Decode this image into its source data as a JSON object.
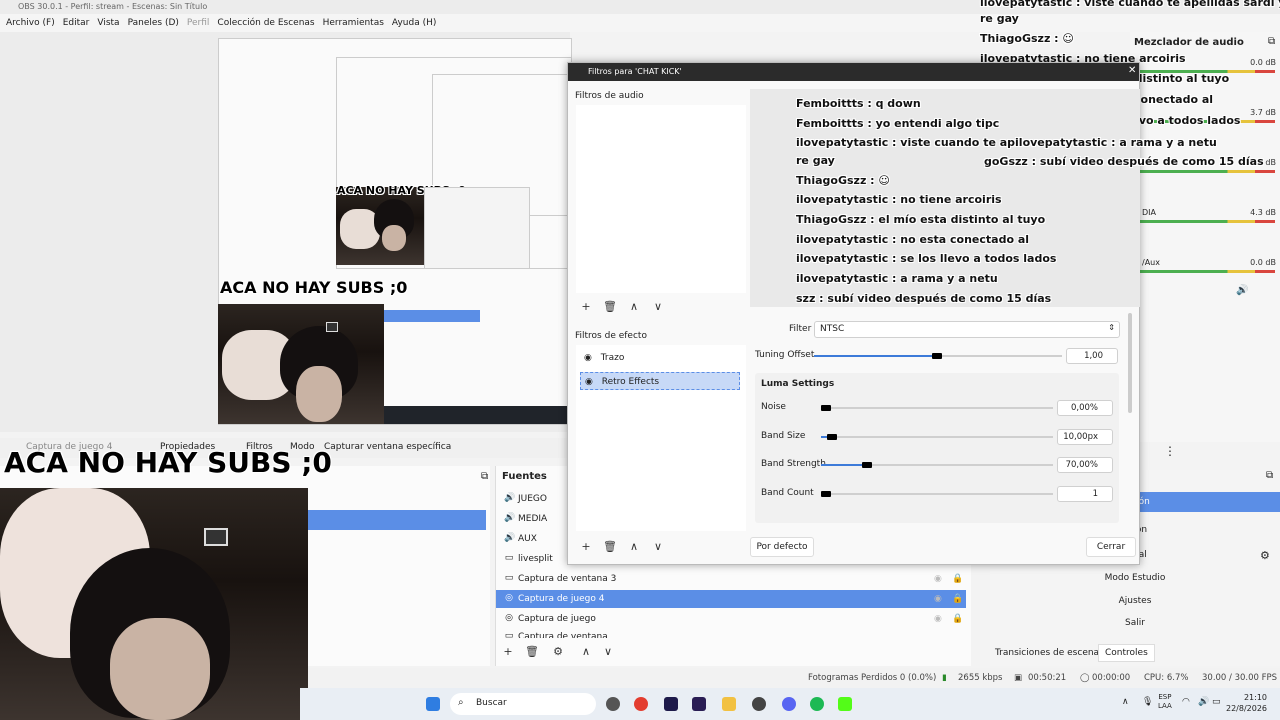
{
  "window": {
    "title": "OBS 30.0.1 - Perfil: stream - Escenas: Sin Título"
  },
  "menu": {
    "items": [
      "Archivo (F)",
      "Editar",
      "Vista",
      "Paneles (D)",
      "Perfil",
      "Colección de Escenas",
      "Herramientas",
      "Ayuda (H)"
    ]
  },
  "preview": {
    "banner": "ACA NO HAY SUBS ;0"
  },
  "source_toolbar": {
    "items": [
      "Captura de juego 4",
      "Propiedades",
      "Filtros",
      "Modo",
      "Capturar ventana específica"
    ]
  },
  "sources": {
    "title": "Fuentes",
    "items": [
      {
        "label": "JUEGO",
        "icon": "speaker-icon"
      },
      {
        "label": "MEDIA",
        "icon": "speaker-icon"
      },
      {
        "label": "AUX",
        "icon": "speaker-icon"
      },
      {
        "label": "livesplit",
        "icon": "window-icon"
      },
      {
        "label": "Captura de ventana 3",
        "icon": "window-icon"
      },
      {
        "label": "Captura de juego 4",
        "icon": "gamepad-icon"
      },
      {
        "label": "Captura de juego",
        "icon": "gamepad-icon"
      },
      {
        "label": "Captura de ventana",
        "icon": "window-icon"
      }
    ]
  },
  "dialog": {
    "title": "Filtros para 'CHAT KICK'",
    "audio_filters_label": "Filtros de audio",
    "effect_filters_label": "Filtros de efecto",
    "effect_filters": [
      "Trazo",
      "Retro Effects"
    ],
    "filter_label": "Filter",
    "filter_value": "NTSC",
    "tuning_offset_label": "Tuning Offset",
    "tuning_offset_value": "1,00",
    "luma_title": "Luma Settings",
    "params": [
      {
        "label": "Noise",
        "value": "0,00%",
        "fill": 0.0
      },
      {
        "label": "Band Size",
        "value": "10,00px",
        "fill": 0.1
      },
      {
        "label": "Band Strength",
        "value": "70,00%",
        "fill": 0.7
      },
      {
        "label": "Band Count",
        "value": "1",
        "fill": 0.0
      }
    ],
    "default_button": "Por defecto",
    "close_button": "Cerrar"
  },
  "chat_preview": {
    "lines": [
      "Femboittts : q down",
      "Femboittts : yo entendi algo tipc",
      "ilovepatytastic : viste cuando te apilovepatytastic : a rama y a netu",
      "re gay",
      "ThiagoGszz : ☺",
      "ilovepatytastic : no tiene arcoiris",
      "ThiagoGszz : el mío esta distinto al tuyo",
      "ilovepatytastic : no esta conectado al",
      "ilovepatytastic : se los llevo a todos lados",
      "ilovepatytastic : a rama y a netu",
      "szz : subí video después de como 15 días"
    ],
    "extra": "goGszz : subí video después de como 15 días"
  },
  "chat_overlay": {
    "lines": [
      "ilovepatytastic : viste cuando te apellidas sardi y sos",
      "re gay",
      "ThiagoGszz : ☺",
      "ilovepatytastic : no tiene arcoiris",
      "ThiagoGszz : el mío esta distinto al tuyo",
      "ilovepatytastic : no esta conectado al",
      "ilovepatytastic : se los llevo a todos lados"
    ]
  },
  "mixer": {
    "title": "Mezclador de audio",
    "dbs": [
      "0.0 dB",
      "3.7 dB",
      "0.0 dB",
      "4.3 dB",
      "0.0 dB"
    ],
    "labels": [
      "DIA",
      "/Aux"
    ]
  },
  "controls": {
    "items": [
      "misión",
      "ación",
      "irtual",
      "Modo Estudio",
      "Ajustes",
      "Salir"
    ],
    "tabs": [
      "Transiciones de escena",
      "Controles"
    ]
  },
  "status": {
    "dropped": "Fotogramas Perdidos 0 (0.0%)",
    "bitrate": "2655 kbps",
    "live": "00:50:21",
    "rec": "00:00:00",
    "cpu": "CPU: 6.7%",
    "fps": "30.00 / 30.00 FPS"
  },
  "taskbar": {
    "search": "Buscar",
    "lang1": "ESP",
    "lang2": "LAA",
    "time": "21:10",
    "date": "22/8/2026"
  }
}
